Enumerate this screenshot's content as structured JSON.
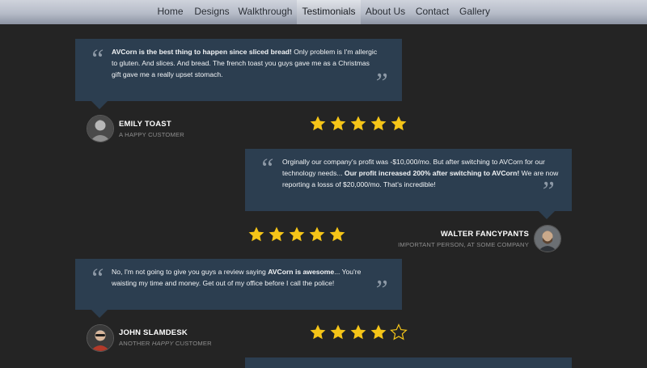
{
  "nav": {
    "items": [
      {
        "label": "Home"
      },
      {
        "label": "Designs"
      },
      {
        "label": "Walkthrough"
      },
      {
        "label": "Testimonials",
        "active": true
      },
      {
        "label": "About Us"
      },
      {
        "label": "Contact"
      },
      {
        "label": "Gallery"
      }
    ]
  },
  "colors": {
    "background": "#242424",
    "card": "#2c3e50",
    "star": "#f5c518",
    "quote_mark": "#8d99a6"
  },
  "testimonials": [
    {
      "text_parts": [
        {
          "bold": true,
          "text": "AVCorn is the best thing to happen since sliced bread!"
        },
        {
          "bold": false,
          "text": " Only problem is I'm allergic to gluten. And slices. And bread. The french toast you guys gave me as a Christmas gift gave me a really upset stomach."
        }
      ],
      "name": "EMILY TOAST",
      "role_parts": [
        {
          "italic": false,
          "text": "A HAPPY CUSTOMER"
        }
      ],
      "rating": 5,
      "max_rating": 5,
      "avatar_icon": "person-avatar-icon"
    },
    {
      "text_parts": [
        {
          "bold": false,
          "text": "Orginally our company's profit was -$10,000/mo. But after switching to AVCorn for our technology needs... "
        },
        {
          "bold": true,
          "text": "Our profit increased 200% after switching to AVCorn!"
        },
        {
          "bold": false,
          "text": " We are now reporting a losss of $20,000/mo. That's incredible!"
        }
      ],
      "name": "WALTER FANCYPANTS",
      "role_parts": [
        {
          "italic": false,
          "text": "IMPORTANT PERSON, AT SOME COMPANY"
        }
      ],
      "rating": 5,
      "max_rating": 5,
      "avatar_icon": "person-avatar-icon"
    },
    {
      "text_parts": [
        {
          "bold": false,
          "text": "No, I'm not going to give you guys a review saying "
        },
        {
          "bold": true,
          "text": "AVCorn is awesome"
        },
        {
          "bold": false,
          "text": "... You're waisting my time and money. Get out of my office before I call the police!"
        }
      ],
      "name": "JOHN SLAMDESK",
      "role_parts": [
        {
          "italic": false,
          "text": "ANOTHER "
        },
        {
          "italic": true,
          "text": "HAPPY"
        },
        {
          "italic": false,
          "text": " CUSTOMER"
        }
      ],
      "rating": 4,
      "max_rating": 5,
      "avatar_icon": "person-avatar-icon"
    }
  ]
}
